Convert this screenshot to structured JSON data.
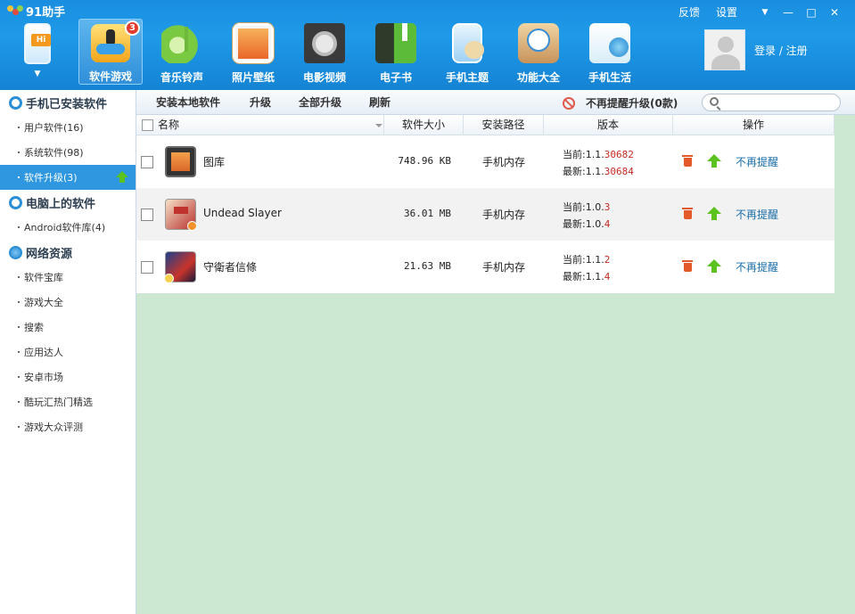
{
  "app": {
    "title": "91助手"
  },
  "window": {
    "feedback": "反馈",
    "settings": "设置",
    "dropdown": "▼",
    "minimize": "—",
    "maximize": "□",
    "close": "✕"
  },
  "nav": [
    {
      "label": "",
      "icon": "phone-hi-icon"
    },
    {
      "label": "软件游戏",
      "icon": "gamepad-icon",
      "badge": "3"
    },
    {
      "label": "音乐铃声",
      "icon": "music-icon"
    },
    {
      "label": "照片壁纸",
      "icon": "photo-icon"
    },
    {
      "label": "电影视频",
      "icon": "film-reel-icon"
    },
    {
      "label": "电子书",
      "icon": "ebook-icon"
    },
    {
      "label": "手机主题",
      "icon": "theme-palette-icon"
    },
    {
      "label": "功能大全",
      "icon": "toolbox-icon"
    },
    {
      "label": "手机生活",
      "icon": "life-bag-icon"
    }
  ],
  "login": {
    "text": "登录 / 注册"
  },
  "sidebar": {
    "sections": [
      {
        "title": "手机已安装软件",
        "items": [
          "用户软件(16)",
          "系统软件(98)",
          "软件升级(3)"
        ]
      },
      {
        "title": "电脑上的软件",
        "items": [
          "Android软件库(4)"
        ]
      },
      {
        "title": "网络资源",
        "items": [
          "软件宝库",
          "游戏大全",
          "搜索",
          "应用达人",
          "安卓市场",
          "酷玩汇热门精选",
          "游戏大众评测"
        ]
      }
    ]
  },
  "toolbar": {
    "install_local": "安装本地软件",
    "upgrade": "升级",
    "upgrade_all": "全部升级",
    "refresh": "刷新",
    "no_remind": "不再提醒升级(0款)",
    "search_placeholder": ""
  },
  "table": {
    "headers": {
      "name": "名称",
      "size": "软件大小",
      "path": "安装路径",
      "version": "版本",
      "action": "操作"
    },
    "rows": [
      {
        "name": "图库",
        "size": "748.96 KB",
        "path": "手机内存",
        "cur_prefix": "当前:1.1.",
        "cur_suffix": "30682",
        "new_prefix": "最新:1.1.",
        "new_suffix": "30684",
        "no_remind": "不再提醒"
      },
      {
        "name": "Undead Slayer",
        "size": "36.01 MB",
        "path": "手机内存",
        "cur_prefix": "当前:1.0.",
        "cur_suffix": "3",
        "new_prefix": "最新:1.0.",
        "new_suffix": "4",
        "no_remind": "不再提醒"
      },
      {
        "name": "守衛者信條",
        "size": "21.63 MB",
        "path": "手机内存",
        "cur_prefix": "当前:1.1.",
        "cur_suffix": "2",
        "new_prefix": "最新:1.1.",
        "new_suffix": "4",
        "no_remind": "不再提醒"
      }
    ]
  },
  "colors": {
    "title_bar": "#1e9ae8",
    "accent": "#2e97e0",
    "upgrade_green": "#5cc21f",
    "content_bg": "#cde8d2",
    "version_red": "#c62b24"
  }
}
